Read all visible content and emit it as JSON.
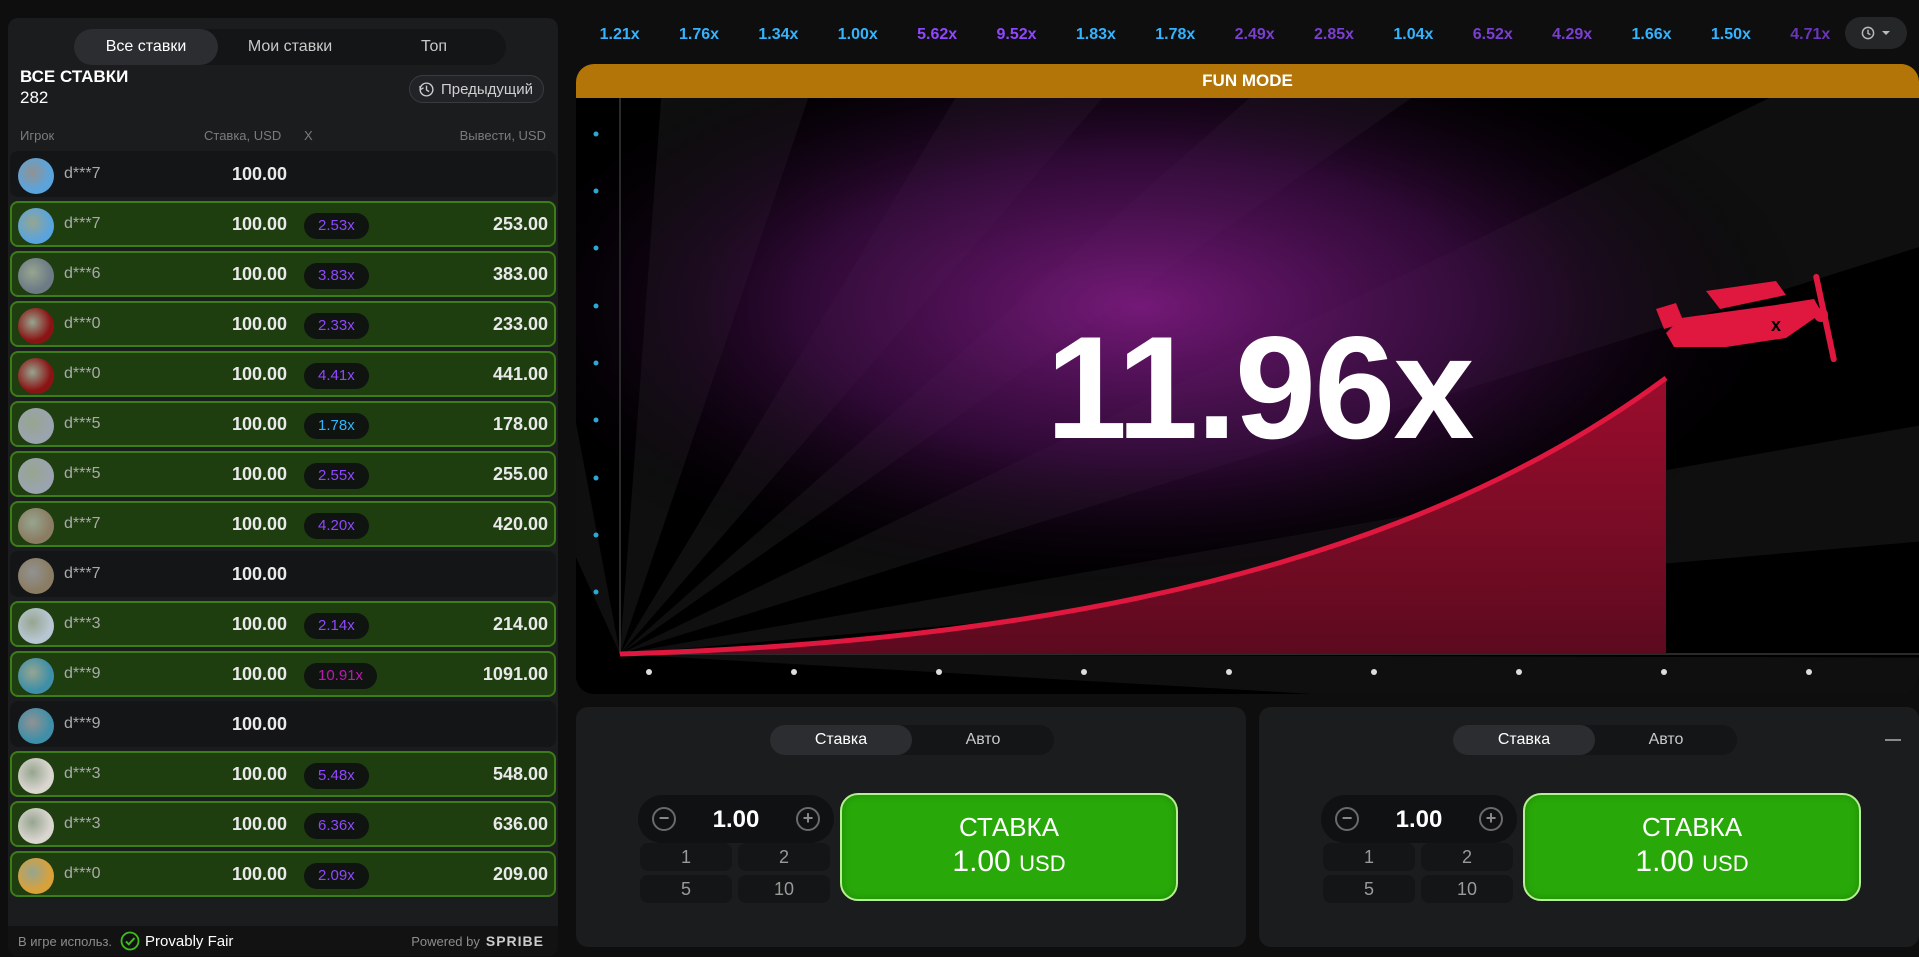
{
  "left_panel": {
    "tabs": [
      "Все ставки",
      "Мои ставки",
      "Топ"
    ],
    "title": "ВСЕ СТАВКИ",
    "count": "282",
    "previous_label": "Предыдущий",
    "columns": {
      "player": "Игрок",
      "stake": "Ставка, USD",
      "mult": "X",
      "cashout": "Вывести, USD"
    },
    "rows": [
      {
        "player": "d***7",
        "stake": "100.00",
        "mult": "",
        "cashout": "",
        "win": false,
        "avatar": "#5aa4dd",
        "mult_color": ""
      },
      {
        "player": "d***7",
        "stake": "100.00",
        "mult": "2.53x",
        "cashout": "253.00",
        "win": true,
        "avatar": "#5aa4dd",
        "mult_color": "#9147ff"
      },
      {
        "player": "d***6",
        "stake": "100.00",
        "mult": "3.83x",
        "cashout": "383.00",
        "win": true,
        "avatar": "#6d7b86",
        "mult_color": "#9147ff"
      },
      {
        "player": "d***0",
        "stake": "100.00",
        "mult": "2.33x",
        "cashout": "233.00",
        "win": true,
        "avatar": "#8a1414",
        "mult_color": "#9147ff"
      },
      {
        "player": "d***0",
        "stake": "100.00",
        "mult": "4.41x",
        "cashout": "441.00",
        "win": true,
        "avatar": "#8a1414",
        "mult_color": "#9147ff"
      },
      {
        "player": "d***5",
        "stake": "100.00",
        "mult": "1.78x",
        "cashout": "178.00",
        "win": true,
        "avatar": "#9aa4ae",
        "mult_color": "#34b4ff"
      },
      {
        "player": "d***5",
        "stake": "100.00",
        "mult": "2.55x",
        "cashout": "255.00",
        "win": true,
        "avatar": "#9aa4ae",
        "mult_color": "#9147ff"
      },
      {
        "player": "d***7",
        "stake": "100.00",
        "mult": "4.20x",
        "cashout": "420.00",
        "win": true,
        "avatar": "#8b7d63",
        "mult_color": "#9147ff"
      },
      {
        "player": "d***7",
        "stake": "100.00",
        "mult": "",
        "cashout": "",
        "win": false,
        "avatar": "#8b7d63",
        "mult_color": ""
      },
      {
        "player": "d***3",
        "stake": "100.00",
        "mult": "2.14x",
        "cashout": "214.00",
        "win": true,
        "avatar": "#b7c6d2",
        "mult_color": "#9147ff"
      },
      {
        "player": "d***9",
        "stake": "100.00",
        "mult": "10.91x",
        "cashout": "1091.00",
        "win": true,
        "avatar": "#3f8fa8",
        "mult_color": "#c017b4"
      },
      {
        "player": "d***9",
        "stake": "100.00",
        "mult": "",
        "cashout": "",
        "win": false,
        "avatar": "#3f8fa8",
        "mult_color": ""
      },
      {
        "player": "d***3",
        "stake": "100.00",
        "mult": "5.48x",
        "cashout": "548.00",
        "win": true,
        "avatar": "#d9d5cf",
        "mult_color": "#9147ff"
      },
      {
        "player": "d***3",
        "stake": "100.00",
        "mult": "6.36x",
        "cashout": "636.00",
        "win": true,
        "avatar": "#d9d5cf",
        "mult_color": "#9147ff"
      },
      {
        "player": "d***0",
        "stake": "100.00",
        "mult": "2.09x",
        "cashout": "209.00",
        "win": true,
        "avatar": "#d9a13a",
        "mult_color": "#9147ff"
      }
    ],
    "footer": {
      "in_game": "В игре использ.",
      "provably_fair": "Provably Fair",
      "powered_by": "Powered by",
      "brand": "SPRIBE"
    }
  },
  "history": [
    {
      "v": "1.21x",
      "c": "#34b4ff"
    },
    {
      "v": "1.76x",
      "c": "#34b4ff"
    },
    {
      "v": "1.34x",
      "c": "#34b4ff"
    },
    {
      "v": "1.00x",
      "c": "#34b4ff"
    },
    {
      "v": "5.62x",
      "c": "#9147ff"
    },
    {
      "v": "9.52x",
      "c": "#9147ff"
    },
    {
      "v": "1.83x",
      "c": "#34b4ff"
    },
    {
      "v": "1.78x",
      "c": "#34b4ff"
    },
    {
      "v": "2.49x",
      "c": "#7a3fd0"
    },
    {
      "v": "2.85x",
      "c": "#7a3fd0"
    },
    {
      "v": "1.04x",
      "c": "#34b4ff"
    },
    {
      "v": "6.52x",
      "c": "#7a3fd0"
    },
    {
      "v": "4.29x",
      "c": "#7a3fd0"
    },
    {
      "v": "1.66x",
      "c": "#34b4ff"
    },
    {
      "v": "1.50x",
      "c": "#34b4ff"
    },
    {
      "v": "4.71x",
      "c": "#6a35b8"
    }
  ],
  "game": {
    "banner": "FUN MODE",
    "multiplier": "11.96x"
  },
  "bet_panels": [
    {
      "tabs": [
        "Ставка",
        "Авто"
      ],
      "amount": "1.00",
      "quick": [
        "1",
        "2",
        "5",
        "10"
      ],
      "button_line1": "СТАВКА",
      "button_amount": "1.00",
      "button_currency": "USD"
    },
    {
      "tabs": [
        "Ставка",
        "Авто"
      ],
      "amount": "1.00",
      "quick": [
        "1",
        "2",
        "5",
        "10"
      ],
      "button_line1": "СТАВКА",
      "button_amount": "1.00",
      "button_currency": "USD"
    }
  ]
}
